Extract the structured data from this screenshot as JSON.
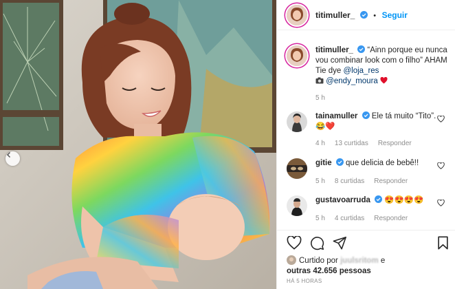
{
  "post": {
    "author": "titimuller_",
    "follow_label": "Seguir",
    "dot": "•"
  },
  "caption": {
    "username": "titimuller_",
    "text": " “Ainn porque eu nunca vou combinar look com o filho” AHAM Tie dye ",
    "mention1": "@loja_res",
    "credit_prefix": " ",
    "mention2": "@endy_moura",
    "time": "5 h"
  },
  "comments": [
    {
      "username": "tainamuller",
      "text": " Ele tá muito “Tito”.",
      "emoji": "😂❤️",
      "time": "4 h",
      "likes": "13 curtidas",
      "reply": "Responder"
    },
    {
      "username": "gitie",
      "text": " que delicia de bebê!!",
      "time": "5 h",
      "likes": "8 curtidas",
      "reply": "Responder"
    },
    {
      "username": "gustavoarruda",
      "text": " 😍😍😍😍",
      "time": "5 h",
      "likes": "4 curtidas",
      "reply": "Responder"
    }
  ],
  "likes": {
    "prefix": "Curtido por ",
    "blurred_user": "juulsritom",
    "connector": " e",
    "others": "outras 42.656 pessoas"
  },
  "posted_ago": "HÁ 5 HORAS",
  "colors": {
    "accent": "#0095f6",
    "verified": "#3897f0",
    "heart": "#ed4956"
  },
  "icons": [
    "chevron-left-icon",
    "verified-icon",
    "heart-icon",
    "comment-icon",
    "share-icon",
    "bookmark-icon",
    "camera-icon"
  ]
}
